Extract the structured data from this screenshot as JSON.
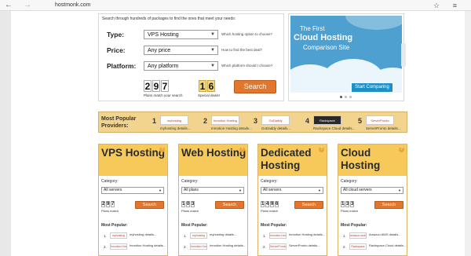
{
  "browser": {
    "back": "←",
    "forward": "→",
    "url": "hostmonk.com",
    "star": "☆",
    "menu": "≡"
  },
  "search": {
    "intro": "Search through hundreds of packages to find the ones that meet your needs:",
    "type": {
      "label": "Type:",
      "value": "VPS Hosting",
      "help": "Which hosting option to choose?"
    },
    "price": {
      "label": "Price:",
      "value": "Any price",
      "help": "How to find the best deal?"
    },
    "platform": {
      "label": "Platform:",
      "value": "Any platform",
      "help": "Which platform should I choose?"
    },
    "plans_digits": [
      "2",
      "9",
      "7"
    ],
    "plans_caption": "Plans match your search",
    "deals_digits": [
      "1",
      "6"
    ],
    "deals_caption": "Special deals!",
    "button": "Search"
  },
  "banner": {
    "line1": "The First",
    "line2": "Cloud Hosting",
    "line3": "Comparison Site",
    "cta": "Start Comparing"
  },
  "providers": {
    "title": "Most Popular Providers:",
    "items": [
      {
        "num": "1",
        "logo": "myhosting",
        "caption": "myhosting details..."
      },
      {
        "num": "2",
        "logo": "Inmotion Hosting",
        "caption": "Inmotion Hosting details..."
      },
      {
        "num": "3",
        "logo": "GoDaddy",
        "caption": "GoDaddy details..."
      },
      {
        "num": "4",
        "logo": "Rackspace",
        "caption": "Rackspace Cloud details..."
      },
      {
        "num": "5",
        "logo": "ServerPronto",
        "caption": "ServerPronto details..."
      }
    ]
  },
  "cards": [
    {
      "name": "VPS Hosting",
      "category_label": "Category:",
      "select": "All servers",
      "digits": [
        "2",
        "9",
        "7"
      ],
      "caption": "Plans match",
      "button": "Search",
      "popular": "Most Popular:",
      "items": [
        {
          "num": "1.",
          "logo": "myhosting",
          "caption": "myhosting details..."
        },
        {
          "num": "2.",
          "logo": "Inmotion Hosting",
          "caption": "Inmotion Hosting details..."
        }
      ]
    },
    {
      "name": "Web Hosting",
      "category_label": "Category:",
      "select": "All plans",
      "digits": [
        "1",
        "0",
        "3"
      ],
      "caption": "Plans match",
      "button": "Search",
      "popular": "Most Popular:",
      "items": [
        {
          "num": "1.",
          "logo": "myhosting",
          "caption": "myhosting details..."
        },
        {
          "num": "2.",
          "logo": "Inmotion Hosting",
          "caption": "Inmotion Hosting details..."
        }
      ]
    },
    {
      "name": "Dedicated Hosting",
      "category_label": "Category:",
      "select": "All servers",
      "digits": [
        "1",
        "4",
        "9",
        "6"
      ],
      "caption": "Plans match",
      "button": "Search",
      "popular": "Most Popular:",
      "items": [
        {
          "num": "1.",
          "logo": "Inmotion Hosting",
          "caption": "Inmotion Hosting details..."
        },
        {
          "num": "2.",
          "logo": "ServerPronto",
          "caption": "ServerPronto details..."
        }
      ]
    },
    {
      "name": "Cloud Hosting",
      "category_label": "Category:",
      "select": "All cloud servers",
      "digits": [
        "1",
        "3",
        "3"
      ],
      "caption": "Plans match",
      "button": "Search",
      "popular": "Most Popular:",
      "items": [
        {
          "num": "1.",
          "logo": "amazon web services",
          "caption": "Amazon AWS details..."
        },
        {
          "num": "2.",
          "logo": "Rackspace",
          "caption": "Rackspace Cloud details..."
        }
      ]
    }
  ]
}
